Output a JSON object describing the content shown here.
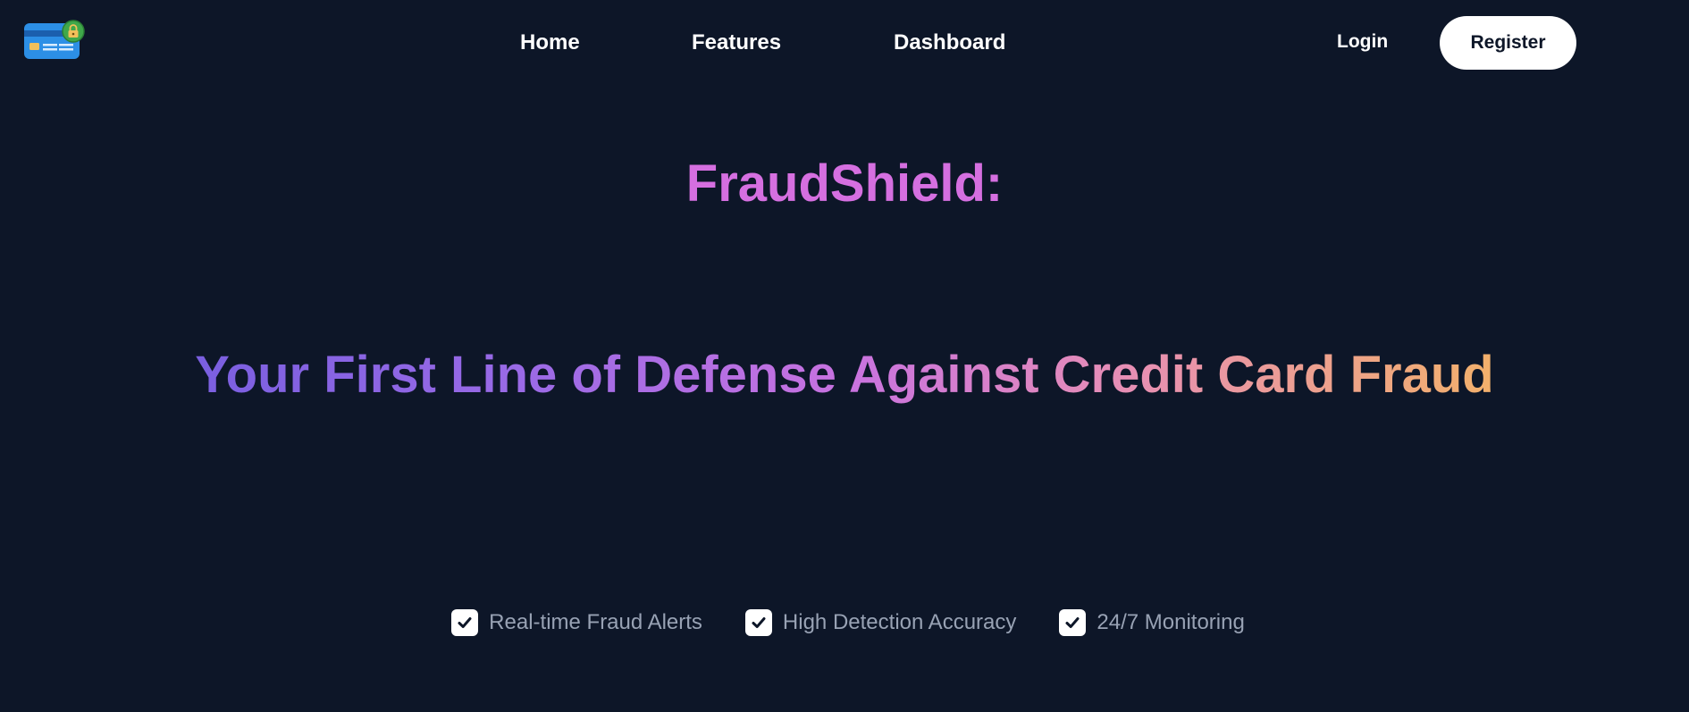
{
  "nav": {
    "logo": "credit-card-lock-icon",
    "links": [
      "Home",
      "Features",
      "Dashboard"
    ],
    "login": "Login",
    "register": "Register"
  },
  "hero": {
    "brand": "FraudShield:",
    "tagline": "Your First Line of Defense Against Credit Card Fraud"
  },
  "features": [
    {
      "label": "Real-time Fraud Alerts",
      "icon": "checkbox-checked-icon"
    },
    {
      "label": "High Detection Accuracy",
      "icon": "checkbox-checked-icon"
    },
    {
      "label": "24/7 Monitoring",
      "icon": "checkbox-checked-icon"
    }
  ],
  "colors": {
    "background": "#0d1628",
    "brand": "#d56fe0",
    "gradient_start": "#7a5fe0",
    "gradient_end": "#f2b06b",
    "feature_text": "#98a2b4"
  }
}
